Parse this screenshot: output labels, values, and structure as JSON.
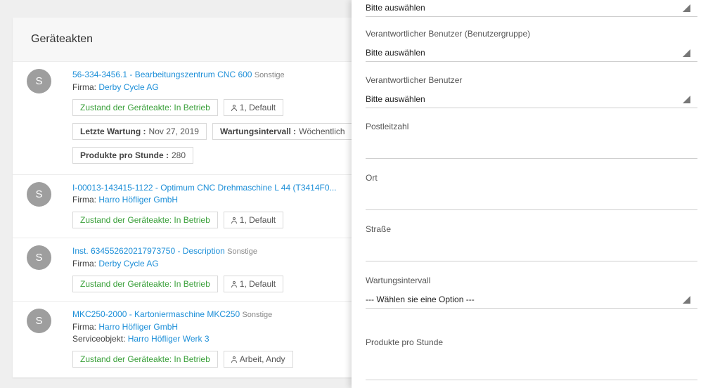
{
  "list": {
    "title": "Geräteakten",
    "entries": [
      {
        "avatar": "S",
        "title": "56-334-3456.1 - Bearbeitungszentrum CNC 600",
        "category": "Sonstige",
        "firma_label": "Firma:",
        "firma": "Derby Cycle AG",
        "status": "Zustand der Geräteakte: In Betrieb",
        "user": "1, Default",
        "letzte_wartung_label": "Letzte Wartung :",
        "letzte_wartung": "Nov 27, 2019",
        "wartungsintervall_label": "Wartungsintervall :",
        "wartungsintervall": "Wöchentlich",
        "produkte_label": "Produkte pro Stunde :",
        "produkte": "280"
      },
      {
        "avatar": "S",
        "title": "I-00013-143415-1122 - Optimum CNC Drehmaschine L 44 (T3414F0...",
        "firma_label": "Firma:",
        "firma": "Harro Höfliger GmbH",
        "status": "Zustand der Geräteakte: In Betrieb",
        "user": "1, Default"
      },
      {
        "avatar": "S",
        "title": "Inst. 634552620217973750 - Description",
        "category": "Sonstige",
        "firma_label": "Firma:",
        "firma": "Derby Cycle AG",
        "status": "Zustand der Geräteakte: In Betrieb",
        "user": "1, Default"
      },
      {
        "avatar": "S",
        "title": "MKC250-2000 - Kartoniermaschine MKC250",
        "category": "Sonstige",
        "firma_label": "Firma:",
        "firma": "Harro Höfliger GmbH",
        "serviceobjekt_label": "Serviceobjekt:",
        "serviceobjekt": "Harro Höfliger Werk 3",
        "status": "Zustand der Geräteakte: In Betrieb",
        "user": "Arbeit, Andy"
      }
    ]
  },
  "filters": {
    "top_select": {
      "value": "Bitte auswählen"
    },
    "benutzergruppe": {
      "label": "Verantwortlicher Benutzer (Benutzergruppe)",
      "value": "Bitte auswählen"
    },
    "benutzer": {
      "label": "Verantwortlicher Benutzer",
      "value": "Bitte auswählen"
    },
    "postleitzahl": {
      "label": "Postleitzahl",
      "value": ""
    },
    "ort": {
      "label": "Ort",
      "value": ""
    },
    "strasse": {
      "label": "Straße",
      "value": ""
    },
    "wartungsintervall": {
      "label": "Wartungsintervall",
      "value": "--- Wählen sie eine Option ---"
    },
    "produkte": {
      "label": "Produkte pro Stunde",
      "value": ""
    }
  },
  "colors": {
    "link": "#1d8fd8",
    "status_green": "#3aa03a",
    "avatar": "#9e9e9e"
  },
  "icons": [
    "user-icon",
    "dropdown-caret-icon"
  ]
}
